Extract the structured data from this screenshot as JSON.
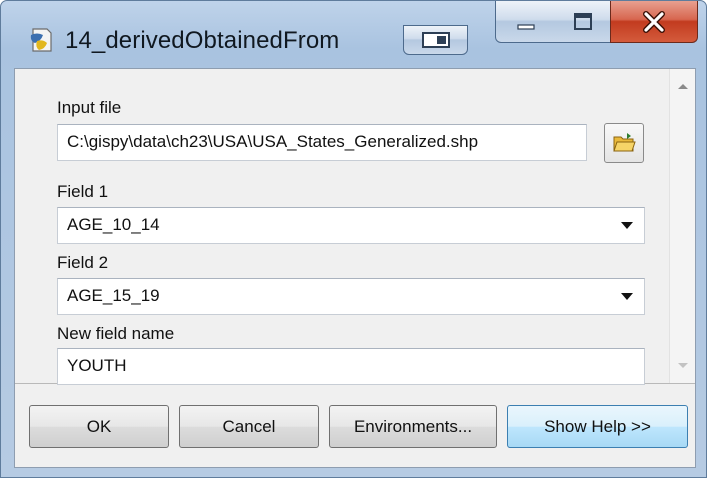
{
  "window": {
    "title": "14_derivedObtainedFrom"
  },
  "form": {
    "input_file_label": "Input file",
    "input_file_value": "C:\\gispy\\data\\ch23\\USA\\USA_States_Generalized.shp",
    "field1_label": "Field 1",
    "field1_value": "AGE_10_14",
    "field2_label": "Field 2",
    "field2_value": "AGE_15_19",
    "new_field_label": "New field name",
    "new_field_value": "YOUTH"
  },
  "buttons": {
    "ok": "OK",
    "cancel": "Cancel",
    "environments": "Environments...",
    "help": "Show Help >>"
  },
  "icons": {
    "app": "python-script-icon",
    "browse": "open-folder-icon",
    "minimize": "minimize-icon",
    "maximize": "maximize-icon",
    "close": "close-icon"
  },
  "colors": {
    "close_button": "#c23b1f",
    "help_button": "#a7d9f5",
    "window_frame": "#b6cbe3"
  }
}
